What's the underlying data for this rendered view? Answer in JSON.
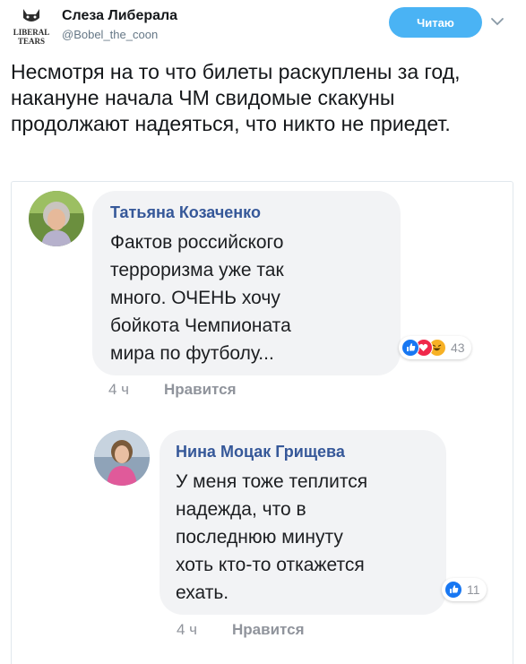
{
  "tweet": {
    "author_name": "Слеза Либерала",
    "author_handle": "@Bobel_the_coon",
    "logo_text": [
      "LIBERAL",
      "TEARS"
    ],
    "follow_label": "Читаю",
    "text": "Несмотря на то что билеты раскуплены за год, накануне начала ЧМ свидомые скакуны продолжают надеяться, что никто не приедет."
  },
  "comments": [
    {
      "name": "Татьяна Козаченко",
      "text": "Фактов российского\nтерроризма уже так\nмного. ОЧЕНЬ хочу\nбойкота Чемпионата\nмира по футболу...",
      "reaction_count": "43",
      "reaction_icons": [
        "like-icon",
        "love-icon",
        "haha-icon"
      ],
      "time": "4 ч",
      "like_label": "Нравится"
    },
    {
      "name": "Нина Моцак Грищева",
      "text": "У меня тоже теплится\nнадежда, что в\nпоследнюю минуту\nхоть кто-то откажется\nехать.",
      "reaction_count": "11",
      "reaction_icons": [
        "like-icon"
      ],
      "time": "4 ч",
      "like_label": "Нравится"
    }
  ],
  "colors": {
    "follow_button": "#4ab3f4",
    "fb_name": "#365899",
    "bubble": "#f2f3f5",
    "like_blue": "#1877f2",
    "love_red": "#f0284a",
    "haha_yellow": "#f7b125"
  }
}
